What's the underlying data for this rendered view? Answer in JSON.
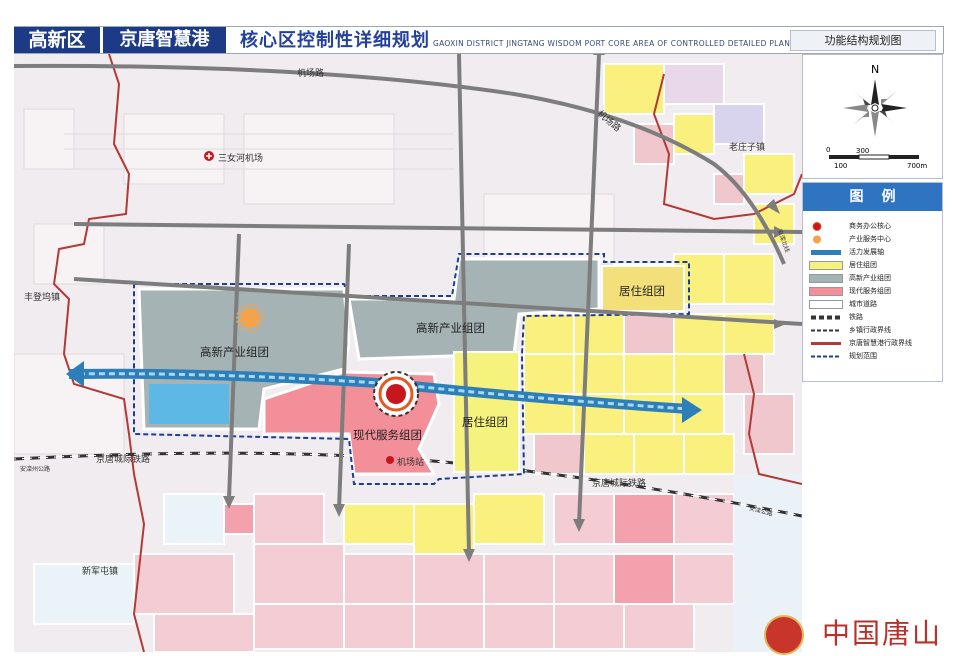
{
  "header": {
    "district": "高新区",
    "port": "京唐智慧港",
    "title": "核心区控制性详细规划",
    "subtitle": "GAOXIN DISTRICT JINGTANG WISDOM PORT CORE AREA OF CONTROLLED DETAILED PLANNING",
    "map_type": "功能结构规划图"
  },
  "places": {
    "airport_road_1": "机场路",
    "airport_road_2": "机场路",
    "airport": "三女河机场",
    "laozhuangzi": "老庄子镇",
    "fengdengwu": "丰登坞镇",
    "xinjuntun": "新军屯镇",
    "jingtang_rail_1": "京唐城际铁路",
    "jingtang_rail_2": "京唐城际铁路",
    "side_road_left": "安滦州公路",
    "side_road_right": "安滦公路",
    "side_road_top": "安滦北线"
  },
  "zones": {
    "industry_west": "高新产业组团",
    "industry_center": "高新产业组团",
    "residence_ne": "居住组团",
    "residence_center": "居住组团",
    "modern_service": "现代服务组团",
    "airport_station": "机场站"
  },
  "compass": {
    "north": "N",
    "scale_0": "0",
    "scale_100": "100",
    "scale_300": "300",
    "scale_700": "700m"
  },
  "legend": {
    "title": "图例",
    "items": [
      {
        "label": "商务办公核心"
      },
      {
        "label": "产业服务中心"
      },
      {
        "label": "活力发展轴"
      },
      {
        "label": "居住组团"
      },
      {
        "label": "高新产业组团"
      },
      {
        "label": "现代服务组团"
      },
      {
        "label": "城市道路"
      },
      {
        "label": "铁路"
      },
      {
        "label": "乡镇行政界线"
      },
      {
        "label": "京唐智慧港行政界线"
      },
      {
        "label": "规划范围"
      }
    ]
  },
  "watermark": "中国唐山",
  "colors": {
    "header_blue": "#1d3a86",
    "industry": "#9aa8a8",
    "industry_blue": "#5eb8e6",
    "residence": "#f6f27e",
    "service": "#f08d95",
    "axis": "#3a8fc7",
    "boundary": "#b23a36",
    "road": "#7d7d7d"
  }
}
